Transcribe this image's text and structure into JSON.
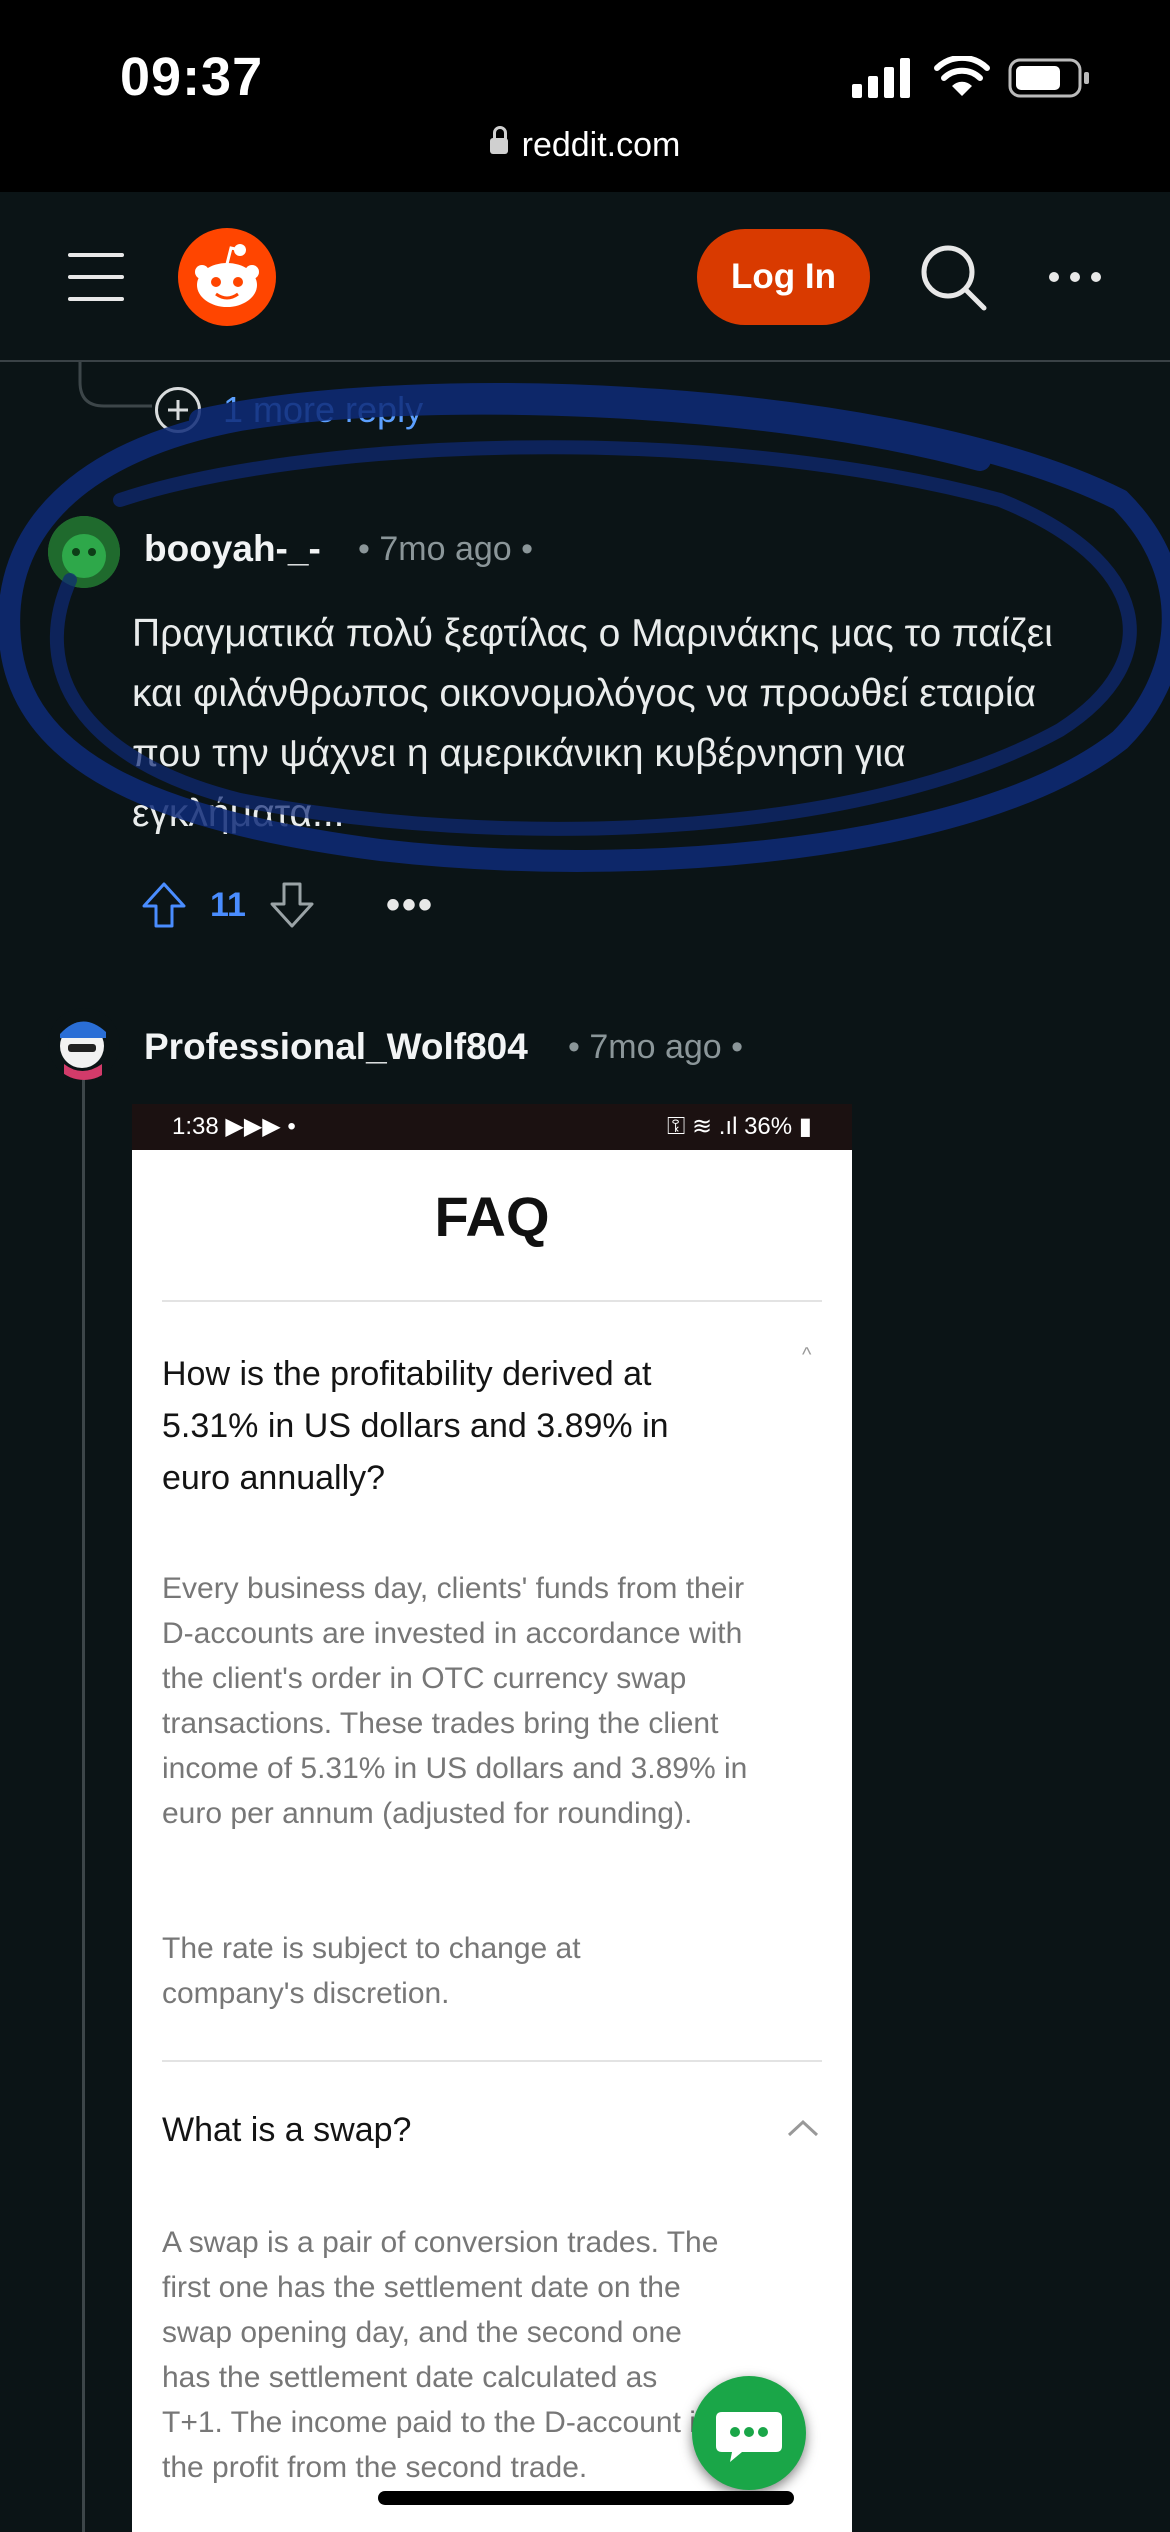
{
  "status_bar": {
    "time": "09:37",
    "url": "reddit.com"
  },
  "header": {
    "login_label": "Log In"
  },
  "thread": {
    "more_replies": "1 more reply"
  },
  "comments": [
    {
      "username": "booyah-_-",
      "age": "7mo ago",
      "text": "Πραγματικά πολύ ξεφτίλας ο Μαρινάκης μας το παίζει και φιλάνθρωπος οικονομολόγος να προωθεί εταιρία που την ψάχνει η αμερικάνικη κυβέρνηση για εγκλήματα...",
      "score": "11"
    },
    {
      "username": "Professional_Wolf804",
      "age": "7mo ago"
    }
  ],
  "embedded_screenshot": {
    "status_time": "1:38",
    "status_right": "36%",
    "title": "FAQ",
    "faq": [
      {
        "question": "How is the profitability derived at 5.31% in US dollars and 3.89% in euro annually?",
        "answer_p1": "Every business day, clients' funds from their D-accounts are invested in accordance with the client's order in OTC currency swap transactions. These trades bring the client income of 5.31% in US dollars and 3.89% in euro per annum (adjusted for rounding).",
        "answer_p2": "The rate is subject to change at company's discretion."
      },
      {
        "question": "What is a swap?",
        "answer_p1": "A swap is a pair of conversion trades. The first one has the settlement date on the swap opening day, and the second one has the settlement date calculated as T+1. The income paid to the D-account is the profit from the second trade."
      }
    ]
  },
  "colors": {
    "accent": "#d93a00",
    "upvote": "#4a8dff",
    "scribble": "#0e2a78",
    "chat_fab": "#1aa648"
  },
  "icons": [
    "menu-icon",
    "reddit-logo-icon",
    "search-icon",
    "more-icon",
    "add-circle-icon",
    "upvote-icon",
    "downvote-icon",
    "chat-icon"
  ]
}
